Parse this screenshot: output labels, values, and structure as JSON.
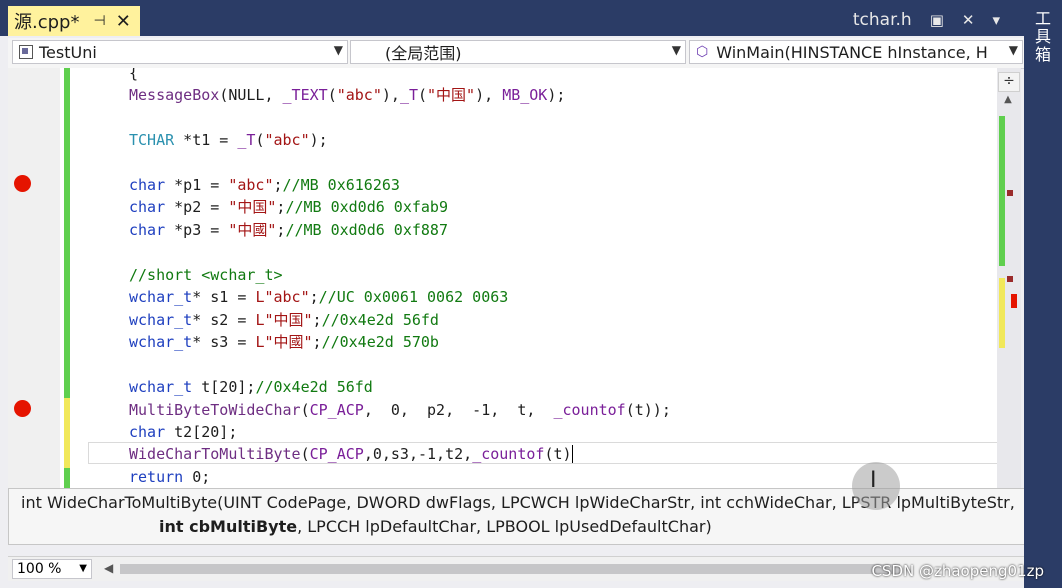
{
  "tabs": {
    "active": {
      "label": "源.cpp*",
      "pin": "⊣",
      "close": "✕"
    },
    "other": {
      "label": "tchar.h",
      "pin": "▣",
      "close": "✕",
      "overflow": "▾"
    }
  },
  "right_strip": {
    "label": "工具箱"
  },
  "navbar": {
    "project": "TestUni",
    "scope": "(全局范围)",
    "member": "WinMain(HINSTANCE hInstance, H"
  },
  "code": {
    "line_brace": "{",
    "messagebox": [
      "MessageBox",
      "(NULL, ",
      "_TEXT",
      "(",
      "\"abc\"",
      "),",
      "_T",
      "(",
      "\"中国\"",
      "), ",
      "MB_OK",
      ");"
    ],
    "tchar": [
      "TCHAR",
      " *t1 = ",
      "_T",
      "(",
      "\"abc\"",
      ");"
    ],
    "p1": [
      "char",
      " *p1 = ",
      "\"abc\"",
      ";",
      "//MB 0x616263"
    ],
    "p2": [
      "char",
      " *p2 = ",
      "\"中国\"",
      ";",
      "//MB 0xd0d6 0xfab9"
    ],
    "p3": [
      "char",
      " *p3 = ",
      "\"中國\"",
      ";",
      "//MB 0xd0d6 0xf887"
    ],
    "short": "//short <wchar_t>",
    "s1": [
      "wchar_t",
      "* s1 = ",
      "L\"abc\"",
      ";",
      "//UC 0x0061 0062 0063"
    ],
    "s2": [
      "wchar_t",
      "* s2 = ",
      "L\"中国\"",
      ";",
      "//0x4e2d 56fd"
    ],
    "s3": [
      "wchar_t",
      "* s3 = ",
      "L\"中國\"",
      ";",
      "//0x4e2d 570b"
    ],
    "t20": [
      "wchar_t",
      " t[20];",
      "//0x4e2d 56fd"
    ],
    "mb2wc": [
      "MultiByteToWideChar",
      "(",
      "CP_ACP",
      ",  0,  p2,  -1,  t,  ",
      "_countof",
      "(t));"
    ],
    "t2": [
      "char",
      " t2[20];"
    ],
    "wc2mb": [
      "WideCharToMultiByte",
      "(",
      "CP_ACP",
      ",0,s3,-1,t2,",
      "_countof",
      "(t)"
    ],
    "ret": [
      "return",
      " 0;"
    ]
  },
  "tooltip": {
    "line1_a": "int WideCharToMultiByte(UINT CodePage, DWORD dwFlags, LPCWCH lpWideCharStr, int cchWideChar, LPSTR lpMultiByteStr,",
    "line2_bold": "int cbMultiByte",
    "line2_rest": ", LPCCH lpDefaultChar, LPBOOL lpUsedDefaultChar)"
  },
  "zoom": "100 %",
  "watermark": "CSDN @zhaopeng01zp"
}
